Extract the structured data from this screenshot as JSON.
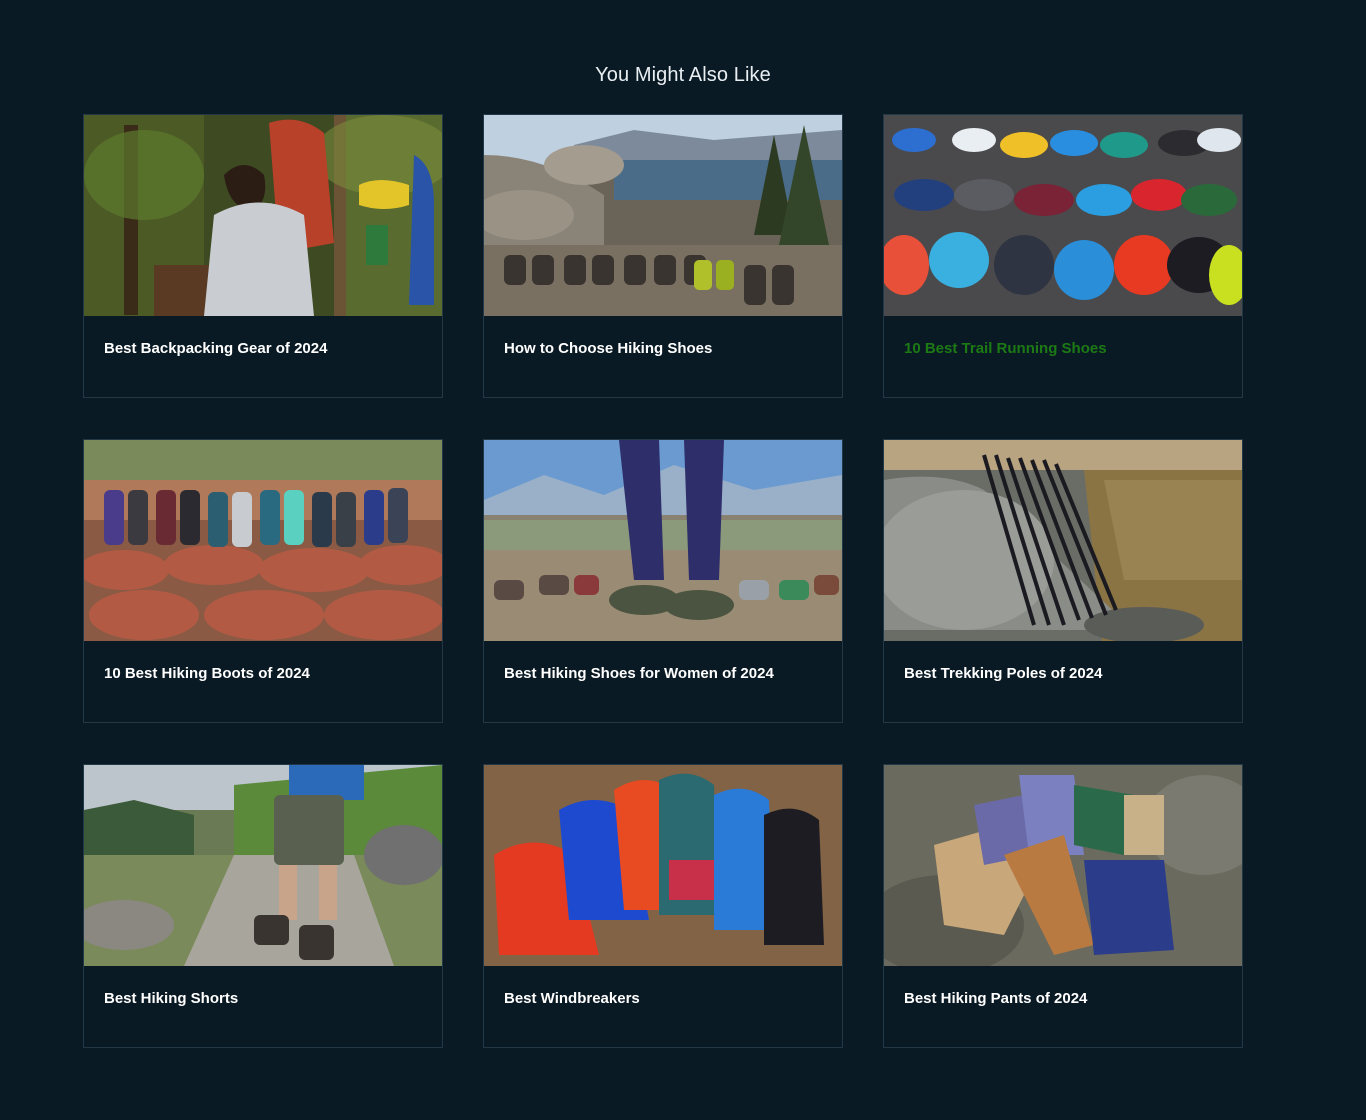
{
  "section": {
    "title": "You Might Also Like"
  },
  "colors": {
    "background": "#0a1a24",
    "card_border": "#223847",
    "title_text": "#ffffff",
    "active_title_text": "#1c7a14"
  },
  "cards": [
    {
      "title": "Best Backpacking Gear of 2024",
      "image": "hiker-with-backpack-photo"
    },
    {
      "title": "How to Choose Hiking Shoes",
      "image": "hiking-shoes-lake-view-photo"
    },
    {
      "title": "10 Best Trail Running Shoes",
      "image": "trail-running-shoes-photo",
      "state": "hover"
    },
    {
      "title": "10 Best Hiking Boots of 2024",
      "image": "hiking-boots-on-rocks-photo"
    },
    {
      "title": "Best Hiking Shoes for Women of 2024",
      "image": "womens-hiking-shoes-photo"
    },
    {
      "title": "Best Trekking Poles of 2024",
      "image": "trekking-poles-by-stream-photo"
    },
    {
      "title": "Best Hiking Shorts",
      "image": "hiking-shorts-trail-photo"
    },
    {
      "title": "Best Windbreakers",
      "image": "windbreaker-jackets-photo"
    },
    {
      "title": "Best Hiking Pants of 2024",
      "image": "hiking-pants-on-rock-photo"
    }
  ]
}
